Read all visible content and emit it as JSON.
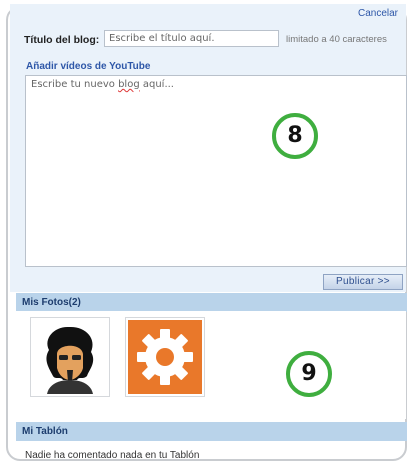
{
  "compose": {
    "cancel_label": "Cancelar",
    "title_label": "Título del blog:",
    "title_placeholder": "Escribe el título aquí.",
    "title_limit": "limitado a 40 caracteres",
    "youtube_link": "Añadir vídeos de YouTube",
    "editor_before": "Escribe tu nuevo ",
    "editor_word": "blog",
    "editor_after": " aquí...",
    "publish_label": "Publicar >>",
    "callout": "8"
  },
  "photos": {
    "header": "Mis Fotos(2)",
    "items": [
      {
        "name": "avatar"
      },
      {
        "name": "gear"
      }
    ],
    "callout": "9"
  },
  "wall": {
    "header": "Mi Tablón",
    "empty_text": "Nadie ha comentado nada en tu Tablón"
  },
  "colors": {
    "accent": "#2e57a8",
    "header_bg": "#b9d3ea",
    "callout_ring": "#3fae3f",
    "gear_bg": "#e9782a"
  }
}
